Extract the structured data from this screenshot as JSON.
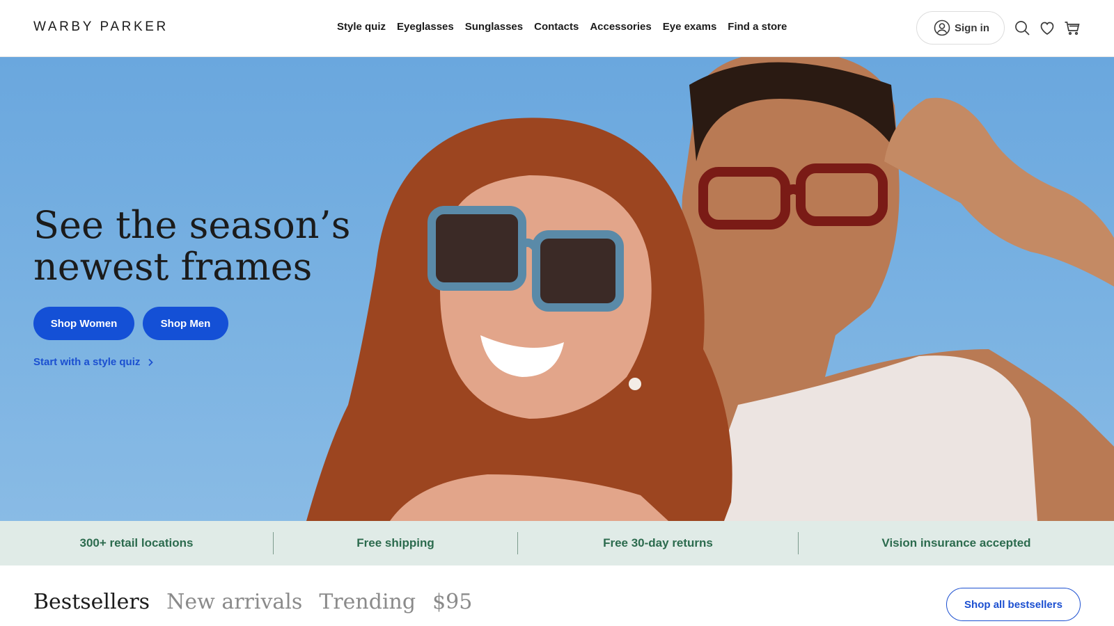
{
  "brand": {
    "logo_text": "WARBY PARKER"
  },
  "nav": {
    "items": [
      "Style quiz",
      "Eyeglasses",
      "Sunglasses",
      "Contacts",
      "Accessories",
      "Eye exams",
      "Find a store"
    ]
  },
  "account": {
    "signin_label": "Sign in"
  },
  "hero": {
    "title": "See the season’s newest frames",
    "shop_women": "Shop Women",
    "shop_men": "Shop Men",
    "quiz_link": "Start with a style quiz"
  },
  "perks": [
    "300+ retail locations",
    "Free shipping",
    "Free 30-day returns",
    "Vision insurance accepted"
  ],
  "products": {
    "tabs": [
      "Bestsellers",
      "New arrivals",
      "Trending",
      "$95"
    ],
    "shop_all": "Shop all bestsellers"
  },
  "colors": {
    "accent": "#1450d6",
    "perk_text": "#2c6b4e",
    "perk_bg": "#e0ebe7",
    "hero_sky": "#6aa7de"
  },
  "icons": [
    "user-icon",
    "search-icon",
    "heart-icon",
    "cart-icon",
    "chevron-right-icon"
  ]
}
